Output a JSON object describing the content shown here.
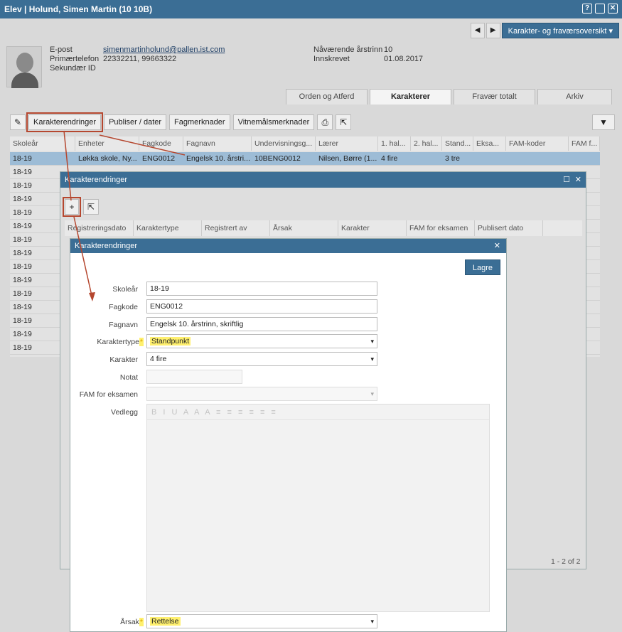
{
  "window": {
    "title": "Elev | Holund, Simen Martin (10 10B)"
  },
  "nav": {
    "prev": "◀",
    "next": "▶",
    "dropdown": "Karakter- og fraværsoversikt"
  },
  "student": {
    "email_label": "E-post",
    "email": "simenmartinholund@pallen.ist.com",
    "phone_label": "Primærtelefon",
    "phone": "22332211, 99663322",
    "secondary_id_label": "Sekundær ID",
    "year_label": "Nåværende årstrinn",
    "year": "10",
    "enrolled_label": "Innskrevet",
    "enrolled": "01.08.2017"
  },
  "tabs": [
    "Orden og Atferd",
    "Karakterer",
    "Fravær totalt",
    "Arkiv"
  ],
  "toolbar": {
    "b1": "Karakterendringer",
    "b2": "Publiser / dater",
    "b3": "Fagmerknader",
    "b4": "Vitnemålsmerknader"
  },
  "grid": {
    "headers": [
      "Skoleår",
      "Enheter",
      "Fagkode",
      "Fagnavn",
      "Undervisningsg...",
      "Lærer",
      "1. hal...",
      "2. hal...",
      "Stand...",
      "Eksa...",
      "FAM-koder",
      "FAM f..."
    ],
    "row1": [
      "18-19",
      "Løkka skole, Ny...",
      "ENG0012",
      "Engelsk 10. årstri...",
      "10BENG0012",
      "Nilsen, Børre (1...",
      "4 fire",
      "",
      "3 tre"
    ],
    "years": [
      "18-19",
      "18-19",
      "18-19",
      "18-19",
      "18-19",
      "18-19",
      "18-19",
      "18-19",
      "18-19",
      "18-19",
      "18-19",
      "18-19",
      "18-19",
      "18-19",
      "18-19"
    ]
  },
  "dialog1": {
    "title": "Karakterendringer",
    "headers": [
      "Registreringsdato",
      "Karaktertype",
      "Registrert av",
      "Årsak",
      "Karakter",
      "FAM for eksamen",
      "Publisert dato"
    ],
    "pager": "1 - 2 of 2"
  },
  "dialog2": {
    "title": "Karakterendringer",
    "save": "Lagre",
    "labels": {
      "skolear": "Skoleår",
      "fagkode": "Fagkode",
      "fagnavn": "Fagnavn",
      "karaktertype": "Karaktertype",
      "karakter": "Karakter",
      "notat": "Notat",
      "fam": "FAM for eksamen",
      "vedlegg": "Vedlegg",
      "arsak": "Årsak"
    },
    "values": {
      "skolear": "18-19",
      "fagkode": "ENG0012",
      "fagnavn": "Engelsk 10. årstrinn, skriftlig",
      "karaktertype": "Standpunkt",
      "karakter": "4 fire",
      "arsak": "Rettelse"
    },
    "required_mark": "*",
    "editor_toolbar": "B I U A A A ≡ ≡ ≡ ≡ ≡ ≡"
  },
  "colors": {
    "accent": "#3b6e95",
    "highlight": "#fff06e",
    "callout": "#b5472f"
  }
}
